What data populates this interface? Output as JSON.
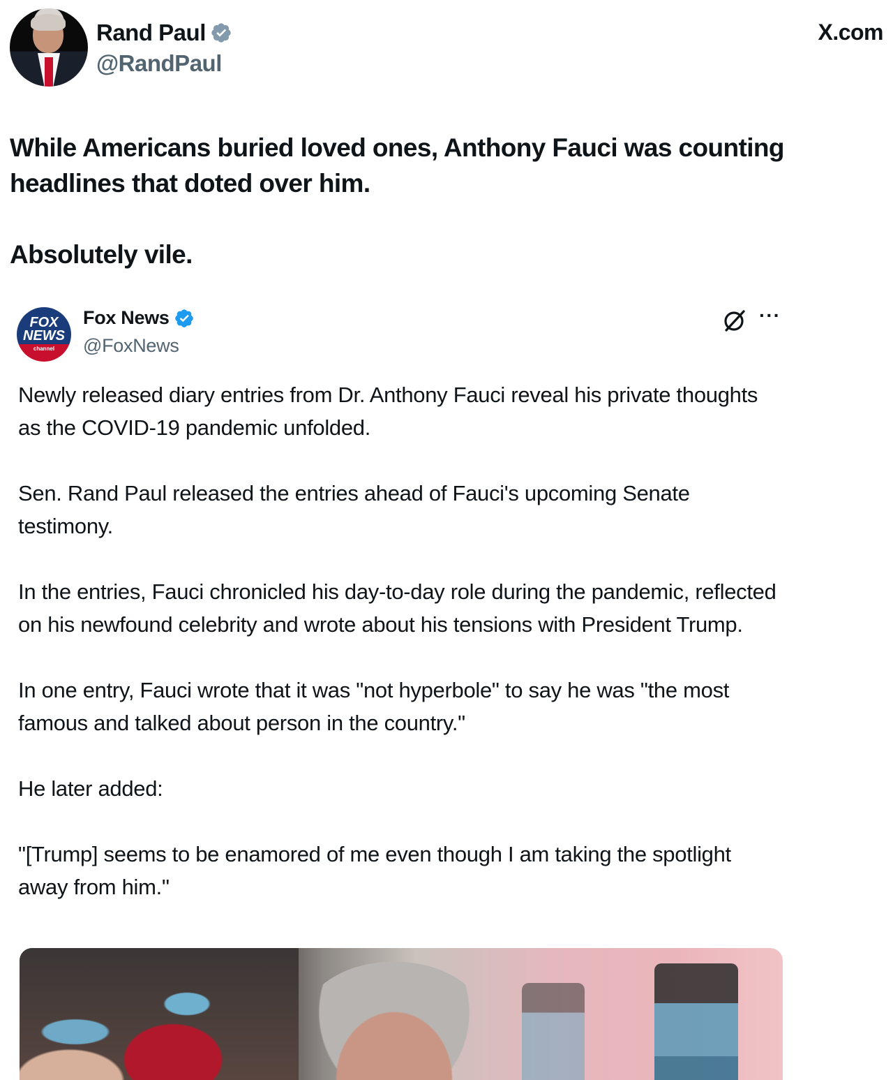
{
  "post": {
    "author_name": "Rand Paul",
    "author_handle": "@RandPaul",
    "brand": "X.com",
    "text_lines": [
      "While Americans buried loved ones, Anthony Fauci was counting headlines that doted over him.",
      "Absolutely vile."
    ]
  },
  "quoted": {
    "logo_lines": [
      "FOX",
      "NEWS",
      "channel"
    ],
    "author_name": "Fox News",
    "author_handle": "@FoxNews",
    "more_label": "···",
    "paragraphs": [
      "Newly released diary entries from Dr. Anthony Fauci reveal his private thoughts as the COVID-19 pandemic unfolded.",
      "Sen. Rand Paul released the entries ahead of Fauci's upcoming Senate testimony.",
      "In the entries, Fauci chronicled his day-to-day role during the pandemic, reflected on his newfound celebrity and wrote about his tensions with President Trump.",
      "In one entry, Fauci wrote that it was \"not hyperbole\" to say he was \"the most famous and talked about person in the country.\"",
      "He later added:",
      "\"[Trump] seems to be enamored of me even though I am taking the spotlight away from him.\""
    ]
  },
  "icons": {
    "verified_grey": "verified-badge-grey-icon",
    "verified_blue": "verified-badge-blue-icon",
    "grok": "grok-icon",
    "more": "more-options-icon"
  },
  "colors": {
    "text": "#0f1419",
    "secondary": "#536471",
    "verified_blue": "#1d9bf0",
    "verified_grey": "#829aab",
    "fox_blue": "#1b3c7a",
    "fox_red": "#c8102e"
  }
}
